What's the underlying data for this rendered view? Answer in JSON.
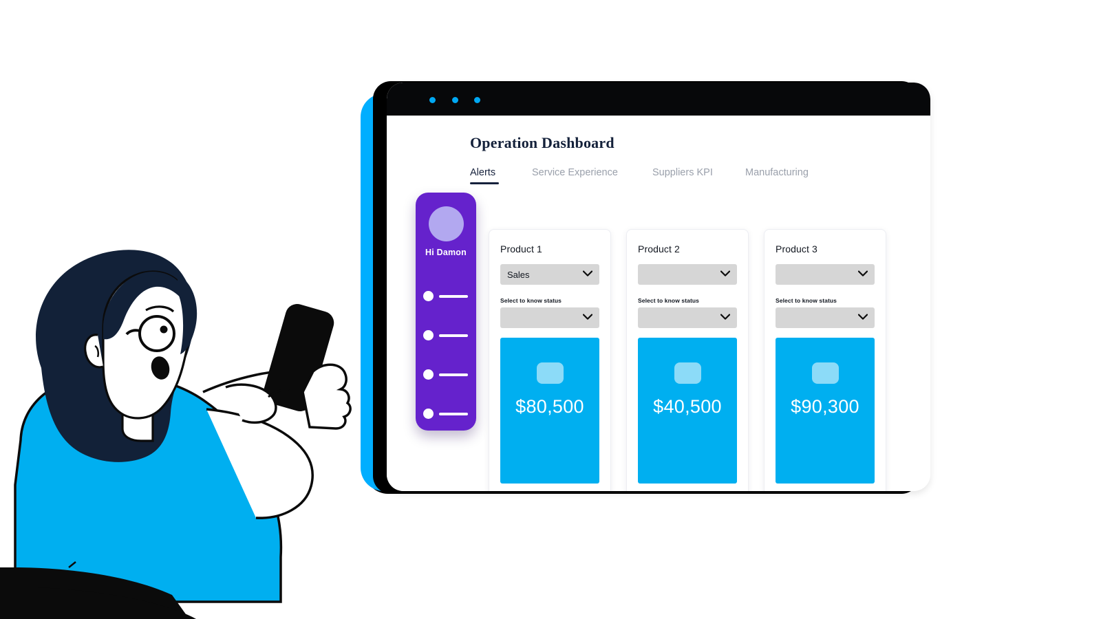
{
  "window": {
    "titlebar_dots": [
      "dot-1",
      "dot-2",
      "dot-3"
    ],
    "accent_blue": "#00AFF0",
    "accent_purple": "#6522CC",
    "frame_black": "#07080A"
  },
  "header": {
    "title": "Operation Dashboard"
  },
  "tabs": [
    {
      "label": "Alerts",
      "active": true
    },
    {
      "label": "Service Experience",
      "active": false
    },
    {
      "label": "Suppliers KPI",
      "active": false
    },
    {
      "label": "Manufacturing",
      "active": false
    }
  ],
  "sidebar": {
    "greeting": "Hi Damon",
    "avatar_icon": "user-avatar-icon",
    "nav_items": [
      {
        "id": "nav-placeholder-1"
      },
      {
        "id": "nav-placeholder-2"
      },
      {
        "id": "nav-placeholder-3"
      },
      {
        "id": "nav-placeholder-4"
      },
      {
        "id": "nav-placeholder-5"
      }
    ]
  },
  "cards": [
    {
      "title": "Product 1",
      "category_select": {
        "value": "Sales",
        "chevron": "chevron-down-icon"
      },
      "hint": "Select to know status",
      "status_select": {
        "value": "",
        "chevron": "chevron-down-icon"
      },
      "metric": {
        "icon": "metric-placeholder-icon",
        "value": "$80,500"
      }
    },
    {
      "title": "Product 2",
      "category_select": {
        "value": "",
        "chevron": "chevron-down-icon"
      },
      "hint": "Select to know status",
      "status_select": {
        "value": "",
        "chevron": "chevron-down-icon"
      },
      "metric": {
        "icon": "metric-placeholder-icon",
        "value": "$40,500"
      }
    },
    {
      "title": "Product 3",
      "category_select": {
        "value": "",
        "chevron": "chevron-down-icon"
      },
      "hint": "Select to know status",
      "status_select": {
        "value": "",
        "chevron": "chevron-down-icon"
      },
      "metric": {
        "icon": "metric-placeholder-icon",
        "value": "$90,300"
      }
    }
  ],
  "illustration": {
    "name": "woman-holding-phone-illustration",
    "shirt_color": "#00AFF0",
    "hair_color": "#122138",
    "phone_color": "#000000"
  }
}
